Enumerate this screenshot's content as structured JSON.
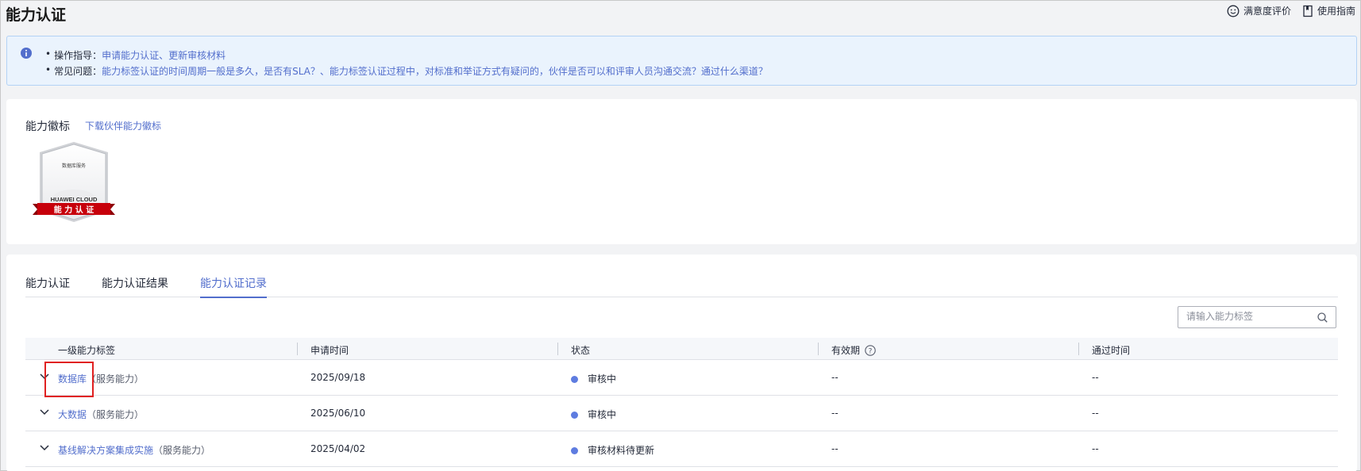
{
  "page": {
    "title": "能力认证"
  },
  "top_actions": {
    "satisfaction": "满意度评价",
    "guide": "使用指南"
  },
  "notice": {
    "bullet": "•",
    "row1_label": "操作指导：",
    "row1_link": "申请能力认证、更新审核材料",
    "row2_label": "常见问题：",
    "row2_link": "能力标签认证的时间周期一般是多久，是否有SLA？、能力标签认证过程中，对标准和举证方式有疑问的，伙伴是否可以和评审人员沟通交流？通过什么渠道？"
  },
  "badge_section": {
    "title": "能力徽标",
    "download_link": "下载伙伴能力徽标",
    "badge": {
      "top_text": "数据库服务",
      "brand": "HUAWEI CLOUD",
      "ribbon": "能 力 认 证",
      "ribbon_color": "#c7000b"
    }
  },
  "tabs": [
    {
      "label": "能力认证",
      "active": false
    },
    {
      "label": "能力认证结果",
      "active": false
    },
    {
      "label": "能力认证记录",
      "active": true
    }
  ],
  "search": {
    "placeholder": "请输入能力标签",
    "value": ""
  },
  "table": {
    "headers": [
      "一级能力标签",
      "申请时间",
      "状态",
      "有效期",
      "通过时间"
    ],
    "help_icon": "?",
    "rows": [
      {
        "tag": "数据库",
        "type": "（服务能力）",
        "date": "2025/09/18",
        "status": "审核中",
        "validity": "--",
        "pass_time": "--"
      },
      {
        "tag": "大数据",
        "type": "（服务能力）",
        "date": "2025/06/10",
        "status": "审核中",
        "validity": "--",
        "pass_time": "--"
      },
      {
        "tag": "基线解决方案集成实施",
        "type": "（服务能力）",
        "date": "2025/04/02",
        "status": "审核材料待更新",
        "validity": "--",
        "pass_time": "--"
      }
    ]
  },
  "colors": {
    "link": "#526ecc",
    "status_dot": "#5e7ce0",
    "highlight": "#e02020"
  }
}
